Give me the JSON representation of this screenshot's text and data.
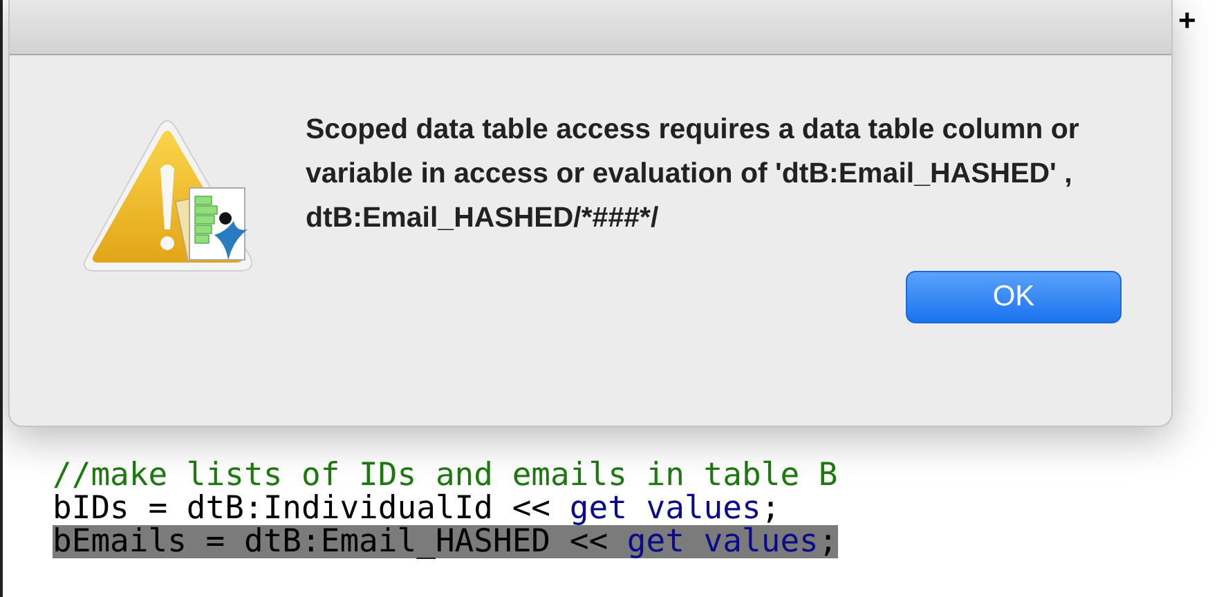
{
  "corner_text": "+",
  "dialog": {
    "message": "Scoped data table access requires a data table column or variable in access or evaluation of 'dtB:Email_HASHED' , dtB:Email_HASHED/*###*/",
    "buttons": [
      {
        "label": "OK",
        "default": true
      }
    ]
  },
  "code": {
    "lines": [
      {
        "selected": false,
        "tokens": [
          {
            "kind": "comment",
            "text": "//make lists of IDs and emails in table B"
          }
        ]
      },
      {
        "selected": false,
        "tokens": [
          {
            "kind": "plain",
            "text": "bIDs = dtB:IndividualId << "
          },
          {
            "kind": "keyword",
            "text": "get values"
          },
          {
            "kind": "plain",
            "text": ";"
          }
        ]
      },
      {
        "selected": true,
        "tokens": [
          {
            "kind": "plain",
            "text": "bEmails = dtB:Email_HASHED << "
          },
          {
            "kind": "keyword",
            "text": "get values"
          },
          {
            "kind": "plain",
            "text": ";"
          }
        ]
      }
    ]
  }
}
